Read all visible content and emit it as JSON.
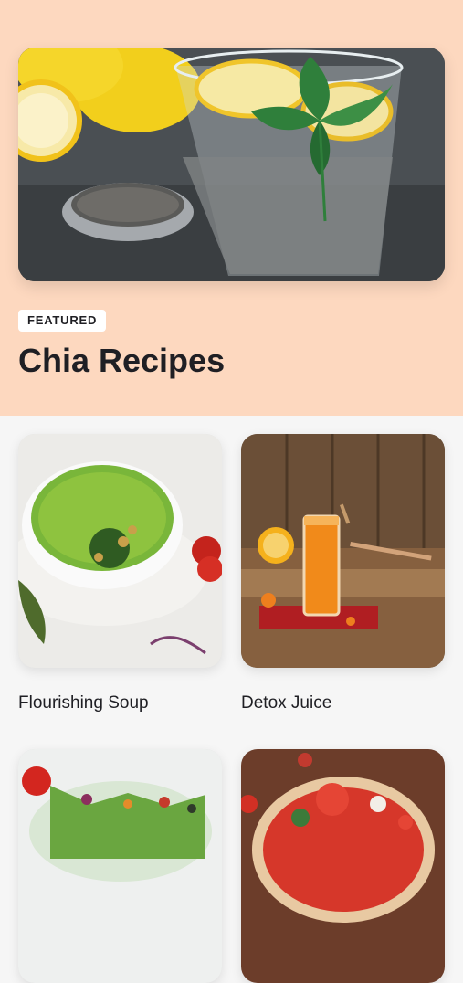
{
  "featured": {
    "badge": "FEATURED",
    "title": "Chia Recipes",
    "image": "chia-water-glass-photo"
  },
  "recipes": [
    {
      "label": "Flourishing Soup",
      "image": "green-soup-bowl-photo"
    },
    {
      "label": "Detox Juice",
      "image": "orange-juice-glass-photo"
    },
    {
      "label": "",
      "image": "mixed-salad-photo"
    },
    {
      "label": "",
      "image": "tomato-pizza-photo"
    }
  ],
  "colors": {
    "hero_background": "#fdd8bf",
    "page_background": "#f6f6f6",
    "text": "#1f1f24"
  }
}
